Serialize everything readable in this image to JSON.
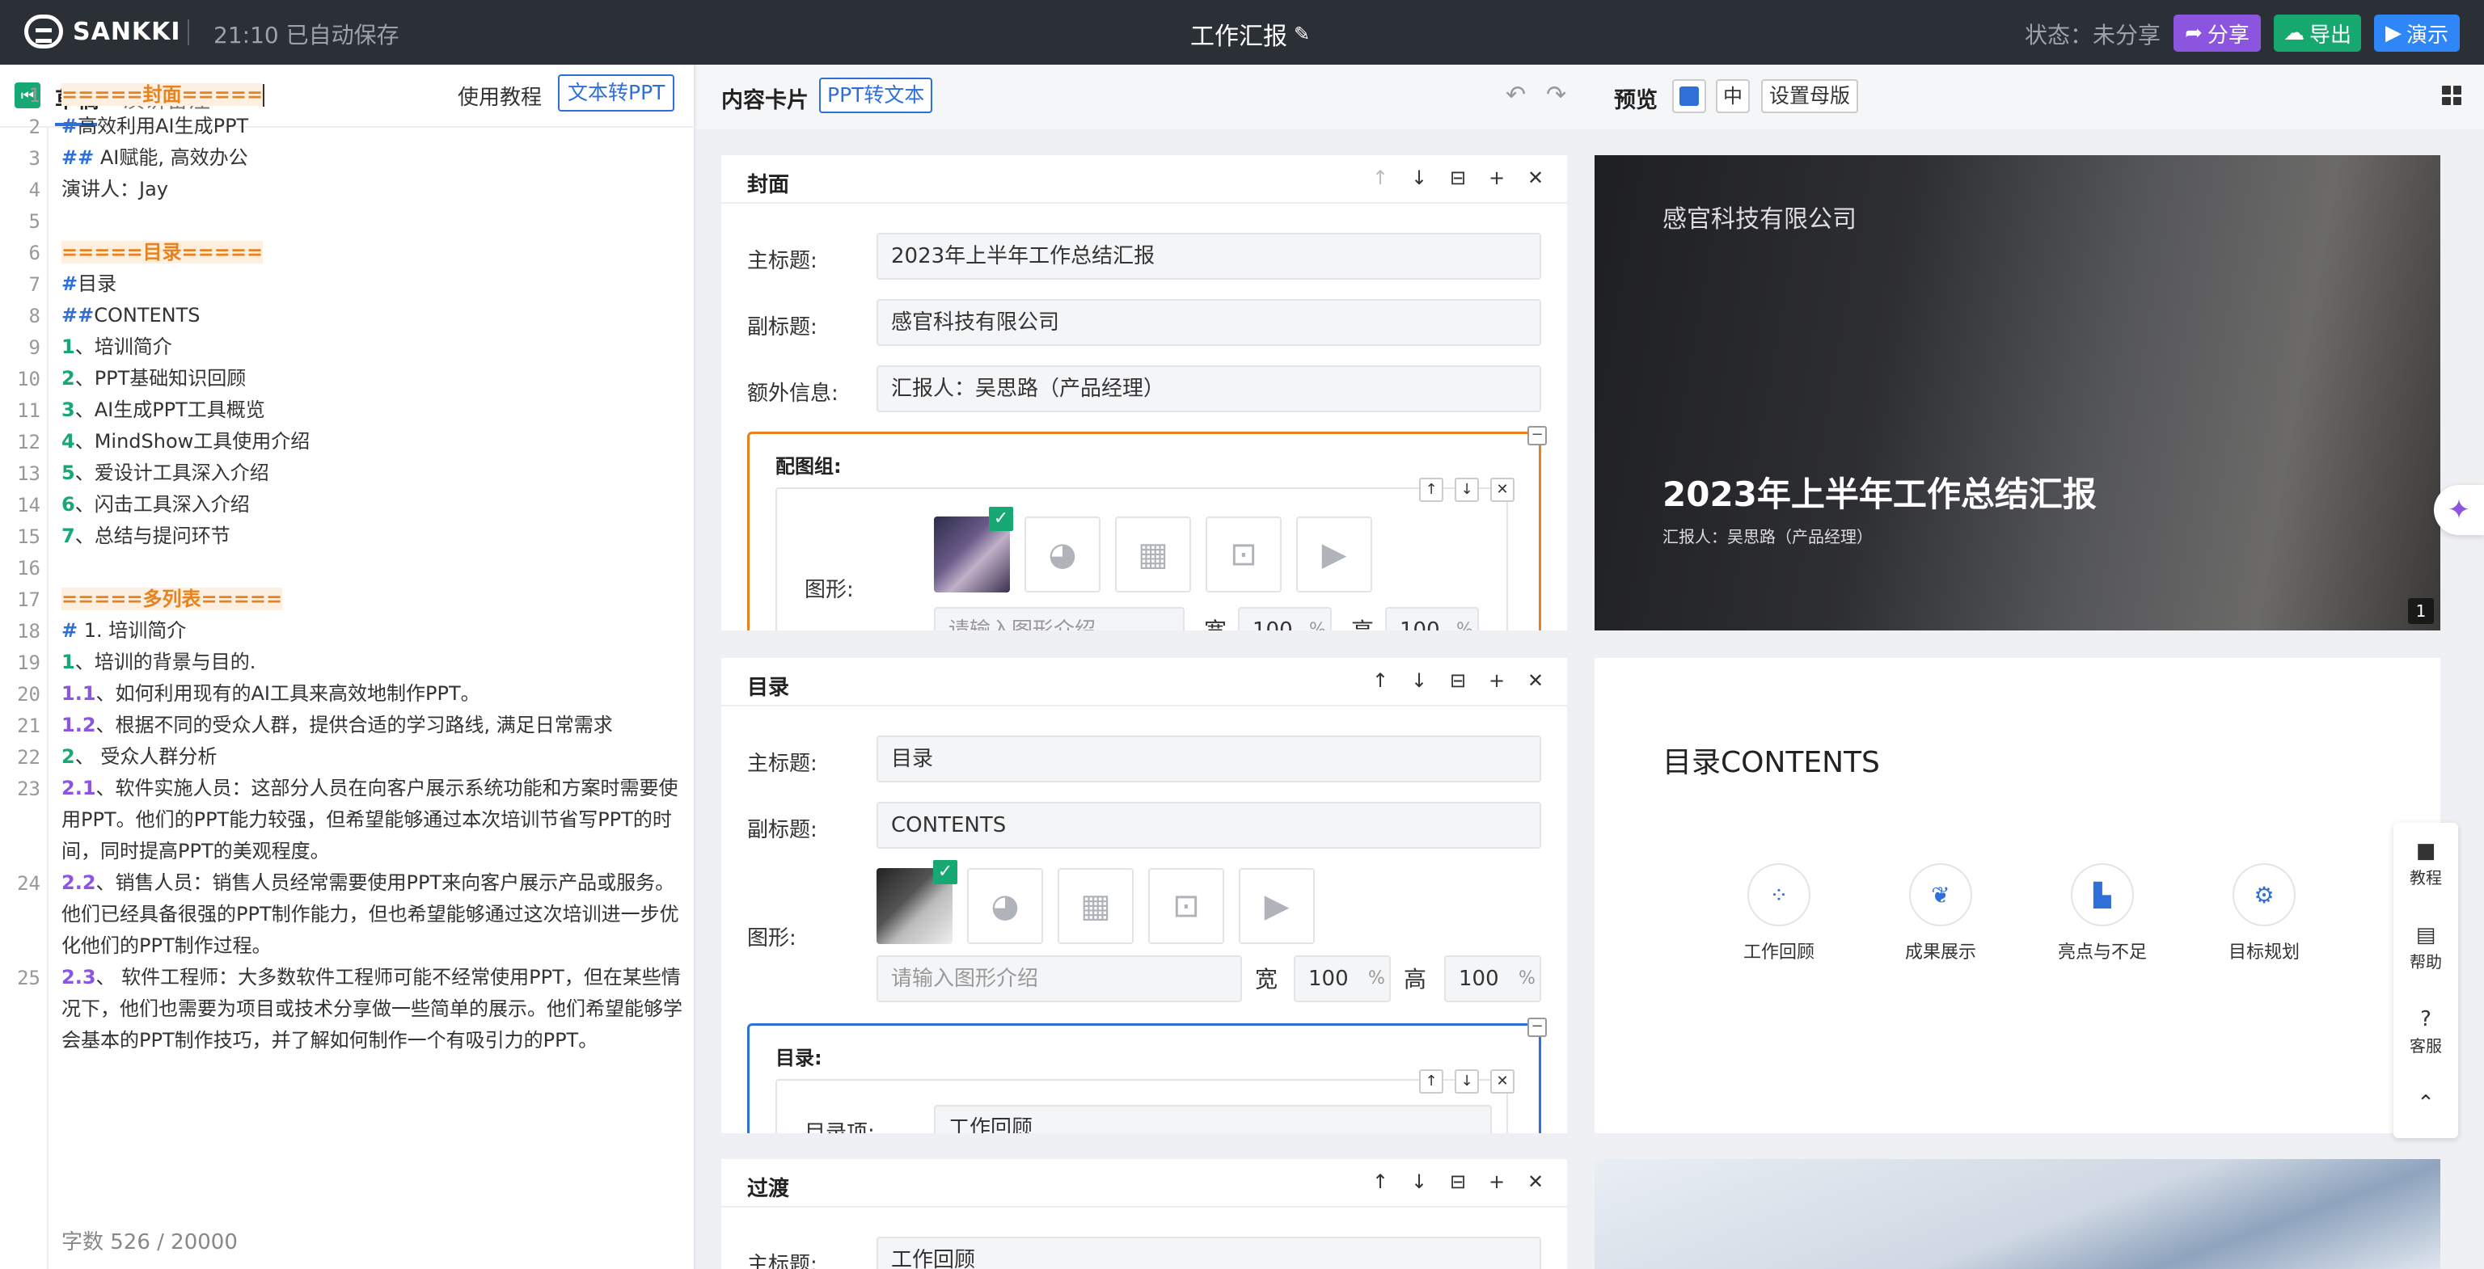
{
  "topbar": {
    "logo": "SANKKI",
    "save_status": "21:10 已自动保存",
    "doc_title": "工作汇报",
    "share_state": "状态：未分享",
    "share": "分享",
    "export": "导出",
    "present": "演示"
  },
  "left": {
    "tab_draft": "草稿",
    "tab_notes": "演讲备注",
    "tutorial": "使用教程",
    "text_to_ppt": "文本转PPT",
    "word_count": "字数  526 / 20000"
  },
  "editor_lines": [
    {
      "n": "1",
      "segs": [
        [
          "sec",
          "=====封面====="
        ]
      ]
    },
    {
      "n": "2",
      "segs": [
        [
          "hash",
          "#"
        ],
        [
          "",
          "高效利用AI生成PPT"
        ]
      ]
    },
    {
      "n": "3",
      "segs": [
        [
          "hash",
          "##"
        ],
        [
          "",
          " AI赋能, 高效办公"
        ]
      ]
    },
    {
      "n": "4",
      "segs": [
        [
          "",
          "演讲人：Jay"
        ]
      ]
    },
    {
      "n": "5",
      "segs": []
    },
    {
      "n": "6",
      "segs": [
        [
          "sec",
          "=====目录====="
        ]
      ]
    },
    {
      "n": "7",
      "segs": [
        [
          "hash",
          "#"
        ],
        [
          "",
          "目录"
        ]
      ]
    },
    {
      "n": "8",
      "segs": [
        [
          "hash",
          "##"
        ],
        [
          "",
          "CONTENTS"
        ]
      ]
    },
    {
      "n": "9",
      "segs": [
        [
          "num",
          "1"
        ],
        [
          "",
          "、培训简介"
        ]
      ]
    },
    {
      "n": "10",
      "segs": [
        [
          "num",
          "2"
        ],
        [
          "",
          "、PPT基础知识回顾"
        ]
      ]
    },
    {
      "n": "11",
      "segs": [
        [
          "num",
          "3"
        ],
        [
          "",
          "、AI生成PPT工具概览"
        ]
      ]
    },
    {
      "n": "12",
      "segs": [
        [
          "num",
          "4"
        ],
        [
          "",
          "、MindShow工具使用介绍"
        ]
      ]
    },
    {
      "n": "13",
      "segs": [
        [
          "num",
          "5"
        ],
        [
          "",
          "、爱设计工具深入介绍"
        ]
      ]
    },
    {
      "n": "14",
      "segs": [
        [
          "num",
          "6"
        ],
        [
          "",
          "、闪击工具深入介绍"
        ]
      ]
    },
    {
      "n": "15",
      "segs": [
        [
          "num",
          "7"
        ],
        [
          "",
          "、总结与提问环节"
        ]
      ]
    },
    {
      "n": "16",
      "segs": []
    },
    {
      "n": "17",
      "segs": [
        [
          "sec",
          "=====多列表====="
        ]
      ]
    },
    {
      "n": "18",
      "segs": [
        [
          "hash",
          "#"
        ],
        [
          "",
          " 1. 培训简介"
        ]
      ]
    },
    {
      "n": "19",
      "segs": [
        [
          "num",
          "1"
        ],
        [
          "",
          "、培训的背景与目的."
        ]
      ]
    },
    {
      "n": "20",
      "segs": [
        [
          "sub",
          "1.1"
        ],
        [
          "",
          "、如何利用现有的AI工具来高效地制作PPT。"
        ]
      ]
    },
    {
      "n": "21",
      "segs": [
        [
          "sub",
          "1.2"
        ],
        [
          "",
          "、根据不同的受众人群，提供合适的学习路线, 满足日常需求"
        ]
      ]
    },
    {
      "n": "22",
      "segs": [
        [
          "num",
          "2"
        ],
        [
          "",
          "、 受众人群分析"
        ]
      ]
    },
    {
      "n": "23",
      "segs": [
        [
          "sub",
          "2.1"
        ],
        [
          "",
          "、软件实施人员：这部分人员在向客户展示系统功能和方案时需要使用PPT。他们的PPT能力较强，但希望能够通过本次培训节省写PPT的时间，同时提高PPT的美观程度。"
        ]
      ]
    },
    {
      "n": "24",
      "segs": [
        [
          "sub",
          "2.2"
        ],
        [
          "",
          "、销售人员：销售人员经常需要使用PPT来向客户展示产品或服务。他们已经具备很强的PPT制作能力，但也希望能够通过这次培训进一步优化他们的PPT制作过程。"
        ]
      ]
    },
    {
      "n": "25",
      "segs": [
        [
          "sub",
          "2.3"
        ],
        [
          "",
          "、 软件工程师：大多数软件工程师可能不经常使用PPT，但在某些情况下，他们也需要为项目或技术分享做一些简单的展示。他们希望能够学会基本的PPT制作技巧，并了解如何制作一个有吸引力的PPT。"
        ]
      ]
    }
  ],
  "middle": {
    "cards_label": "内容卡片",
    "ppt_to_text": "PPT转文本",
    "preview_label": "预览",
    "lang": "中",
    "set_master": "设置母版"
  },
  "card_cover": {
    "title": "封面",
    "main_title_label": "主标题:",
    "main_title_value": "2023年上半年工作总结汇报",
    "subtitle_label": "副标题:",
    "subtitle_value": "感官科技有限公司",
    "extra_label": "额外信息:",
    "extra_value": "汇报人：吴思路（产品经理）",
    "group_title": "配图组:",
    "graphic_label": "图形:",
    "graphic_placeholder": "请输入图形介绍",
    "width_label": "宽",
    "width_value": "100",
    "height_label": "高",
    "height_value": "100",
    "unit": "%"
  },
  "card_toc": {
    "title": "目录",
    "main_title_label": "主标题:",
    "main_title_value": "目录",
    "subtitle_label": "副标题:",
    "subtitle_value": "CONTENTS",
    "graphic_label": "图形:",
    "graphic_placeholder": "请输入图形介绍",
    "width_label": "宽",
    "width_value": "100",
    "height_label": "高",
    "height_value": "100",
    "unit": "%",
    "group_title": "目录:",
    "item_label": "目录项:",
    "item_value": "工作回顾"
  },
  "card_trans": {
    "title": "过渡",
    "main_title_label": "主标题:",
    "main_title_value": "工作回顾"
  },
  "slide1": {
    "company": "感官科技有限公司",
    "title": "2023年上半年工作总结汇报",
    "reporter": "汇报人：吴思路（产品经理）",
    "page": "1"
  },
  "slide2": {
    "title": "目录CONTENTS",
    "items": [
      "工作回顾",
      "成果展示",
      "亮点与不足",
      "目标规划"
    ]
  },
  "side_tools": {
    "tutorial": "教程",
    "help": "帮助",
    "service": "客服"
  },
  "colors": {
    "accent_blue": "#2f6fd8",
    "share_purple": "#8b55e0",
    "export_green": "#17a86f",
    "present_blue": "#2f86f6",
    "section_orange": "#e8811e"
  }
}
